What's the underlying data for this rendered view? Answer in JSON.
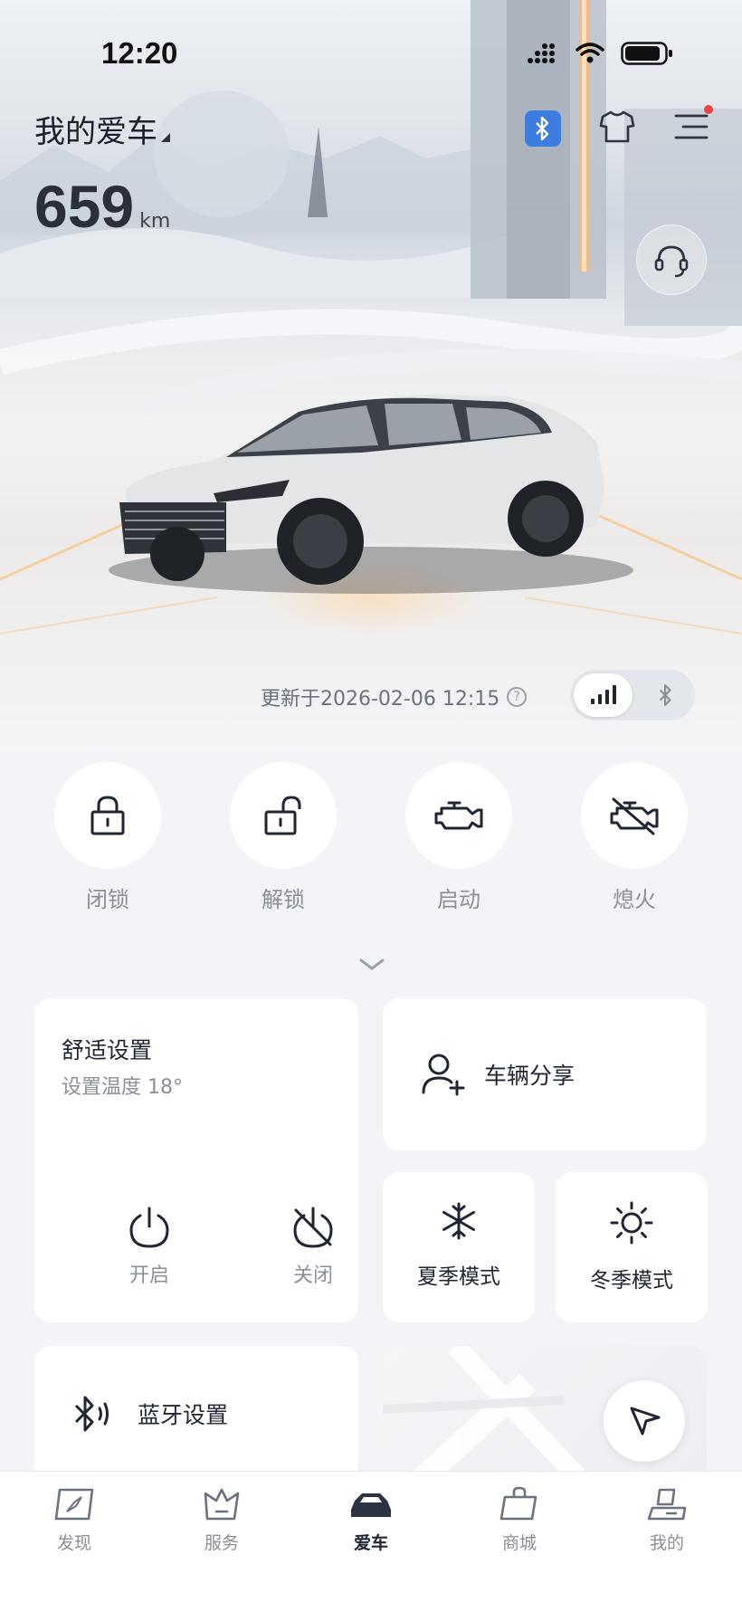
{
  "status_bar": {
    "time": "12:20"
  },
  "header": {
    "title": "我的爱车",
    "range_value": "659",
    "range_unit": "km"
  },
  "update": {
    "text": "更新于2026-02-06 12:15"
  },
  "quick_actions": [
    {
      "label": "闭锁",
      "icon": "lock-icon"
    },
    {
      "label": "解锁",
      "icon": "unlock-icon"
    },
    {
      "label": "启动",
      "icon": "engine-start-icon"
    },
    {
      "label": "熄火",
      "icon": "engine-off-icon"
    }
  ],
  "comfort": {
    "title": "舒适设置",
    "subtitle": "设置温度 18°",
    "on_label": "开启",
    "off_label": "关闭"
  },
  "vehicle_share": {
    "label": "车辆分享"
  },
  "modes": {
    "summer": "夏季模式",
    "winter": "冬季模式"
  },
  "bluetooth": {
    "label": "蓝牙设置"
  },
  "tabs": [
    {
      "label": "发现",
      "icon": "compass-icon",
      "active": false
    },
    {
      "label": "服务",
      "icon": "service-icon",
      "active": false
    },
    {
      "label": "爱车",
      "icon": "car-icon",
      "active": true
    },
    {
      "label": "商城",
      "icon": "shopping-bag-icon",
      "active": false
    },
    {
      "label": "我的",
      "icon": "profile-icon",
      "active": false
    }
  ],
  "colors": {
    "accent_blue": "#3b7ce0",
    "notification_red": "#ef4444",
    "text_dark": "#1f2533",
    "text_gray": "#8a8f99"
  }
}
